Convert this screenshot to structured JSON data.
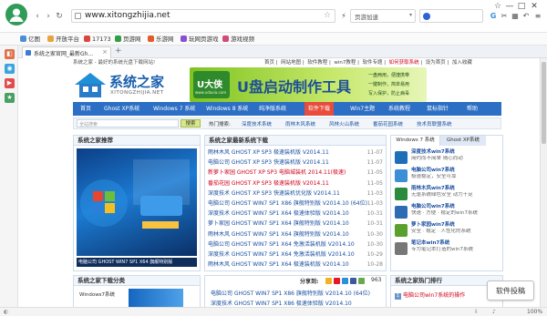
{
  "browser": {
    "url": "www.xitongzhijia.net",
    "tab_title": "系统之家官网_最新Gh...",
    "search_placeholder": "页游加速",
    "search_label": "百度",
    "zoom": "100%",
    "search_box_text": "",
    "win_controls": [
      "☆",
      "—",
      "□",
      "✕"
    ]
  },
  "bookmarks": [
    {
      "label": "亿图",
      "color": "#4a90d9"
    },
    {
      "label": "开放平台",
      "color": "#e8a33a"
    },
    {
      "label": "17173",
      "color": "#d9463e"
    },
    {
      "label": "页游网",
      "color": "#2f9e44"
    },
    {
      "label": "乐游网",
      "color": "#e25b2a"
    },
    {
      "label": "玩网页游戏",
      "color": "#8a4fd0"
    },
    {
      "label": "游戏视频",
      "color": "#d24a7c"
    }
  ],
  "sidebar_icons": [
    {
      "name": "game-icon",
      "color": "#e0704b",
      "glyph": "◧"
    },
    {
      "name": "chat-icon",
      "color": "#3aa4e0",
      "glyph": "◉"
    },
    {
      "name": "video-icon",
      "color": "#e44b4b",
      "glyph": "▶"
    },
    {
      "name": "favorite-icon",
      "color": "#48a062",
      "glyph": "★"
    }
  ],
  "page": {
    "top_nav_left": "系统之家 - 最好的系统光盘下载网站!",
    "top_nav_right": [
      "首页",
      "网站地图",
      "软件教程",
      "win7教程",
      "软件专题",
      "如何获取系统",
      "设为首页",
      "加入收藏"
    ],
    "logo_title": "系统之家",
    "logo_sub": "XITONGZHIJIA.NET",
    "banner_brand": "U大侠",
    "banner_title": "U盘启动制作工具",
    "banner_site": "www.udaxia.com",
    "banner_features": [
      "一盘两用，便捷携带",
      "一键制作，简单易用",
      "写入保护，防止病毒"
    ],
    "menu": [
      "首页",
      "Ghost XP系统",
      "Windows 7 系统",
      "Windows 8 系统",
      "纯净版系统",
      "软件下载",
      "Win7主题",
      "系统教程",
      "鼠标指针",
      "帮助"
    ],
    "search": {
      "placeholder": "全站搜索",
      "button": "搜索",
      "hot_label": "热门搜索:",
      "hot": [
        "深度技术系统",
        "雨林木风系统",
        "风林火山系统",
        "番茄花园系统",
        "技术员联盟系统"
      ]
    },
    "left_panel_title": "系统之家推荐",
    "left_panel_caption": "电脑公司 GHOST WIN7 SP1 X64 旗舰特别版",
    "mid_panel_title": "系统之家最新系统下载",
    "downloads": [
      {
        "text": "雨林木风 GHOST XP SP3 极速装机版 V2014.11",
        "date": "11-07",
        "color": "#1a4fa0"
      },
      {
        "text": "电脑公司 GHOST XP SP3 快速装机版 V2014.11",
        "date": "11-07",
        "color": "#1a4fa0"
      },
      {
        "text": "新萝卜家园 GHOST XP SP3 电脑城装机 2014.11(极速)",
        "date": "11-05",
        "color": "#d0021b"
      },
      {
        "text": "番茄花园 GHOST XP SP3 极速装机版 V2014.11",
        "date": "11-05",
        "color": "#d0021b"
      },
      {
        "text": "深度技术 GHOST XP SP3 快速装机优化版 V2014.11",
        "date": "11-03",
        "color": "#1a4fa0"
      },
      {
        "text": "电脑公司 GHOST WIN7 SP1 X86 旗舰特别版 V2014.10 (64位)",
        "date": "11-03",
        "color": "#1a4fa0"
      },
      {
        "text": "深度技术 GHOST WIN7 SP1 X64 极速体验版 V2014.10",
        "date": "10-31",
        "color": "#1a4fa0"
      },
      {
        "text": "萝卜家园 GHOST WIN7 SP1 X64 旗舰特别版 V2014.10",
        "date": "10-31",
        "color": "#1a4fa0"
      },
      {
        "text": "雨林木风 GHOST WIN7 SP1 X64 旗舰特别版 V2014.10",
        "date": "10-30",
        "color": "#1a4fa0"
      },
      {
        "text": "电脑公司 GHOST WIN7 SP1 X64 免激活装机版 V2014.10",
        "date": "10-30",
        "color": "#1a4fa0"
      },
      {
        "text": "深度技术 GHOST WIN7 SP1 X64 免激活装机版 V2014.10",
        "date": "10-29",
        "color": "#1a4fa0"
      },
      {
        "text": "雨林木风 GHOST WIN7 SP1 X64 极速装机版 V2014.10",
        "date": "10-28",
        "color": "#1a4fa0"
      }
    ],
    "right_tabs": [
      "Windows 7 系统",
      "Ghost XP系统"
    ],
    "right_items": [
      {
        "title": "深度技术win7系统",
        "desc": "简约而不简单 随心而动",
        "color": "#1f6fb8"
      },
      {
        "title": "电脑公司win7系统",
        "desc": "极速稳定，安全可靠",
        "color": "#3b8fd6"
      },
      {
        "title": "雨林木风win7系统",
        "desc": "无驱系统绿色安全 动力十足",
        "color": "#2b8a3e"
      },
      {
        "title": "电脑公司win7系统",
        "desc": "快速 · 方便 · 稳定的win7系统",
        "color": "#2d6cb5"
      },
      {
        "title": "萝卜家园win7系统",
        "desc": "安全 · 稳定 · 人性化的系统",
        "color": "#5aa02c"
      },
      {
        "title": "笔记本win7系统",
        "desc": "专为笔记本打造的win7系统",
        "color": "#777777"
      }
    ],
    "bottom_left_title": "系统之家下载分类",
    "bottom_left_item": "Windows7系统",
    "share_label": "分享到:",
    "share_count": "963",
    "bottom_mid": [
      "电脑公司 GHOST WIN7 SP1 X86 旗舰特别版 V2014.10 (64位)",
      "深度技术 GHOST WIN7 SP1 X86 极速体验版 V2014.10"
    ],
    "bottom_right_title": "系统之家热门排行",
    "bottom_right_item": "电脑公司win7系统的操作",
    "float_button": "软件投稿"
  }
}
